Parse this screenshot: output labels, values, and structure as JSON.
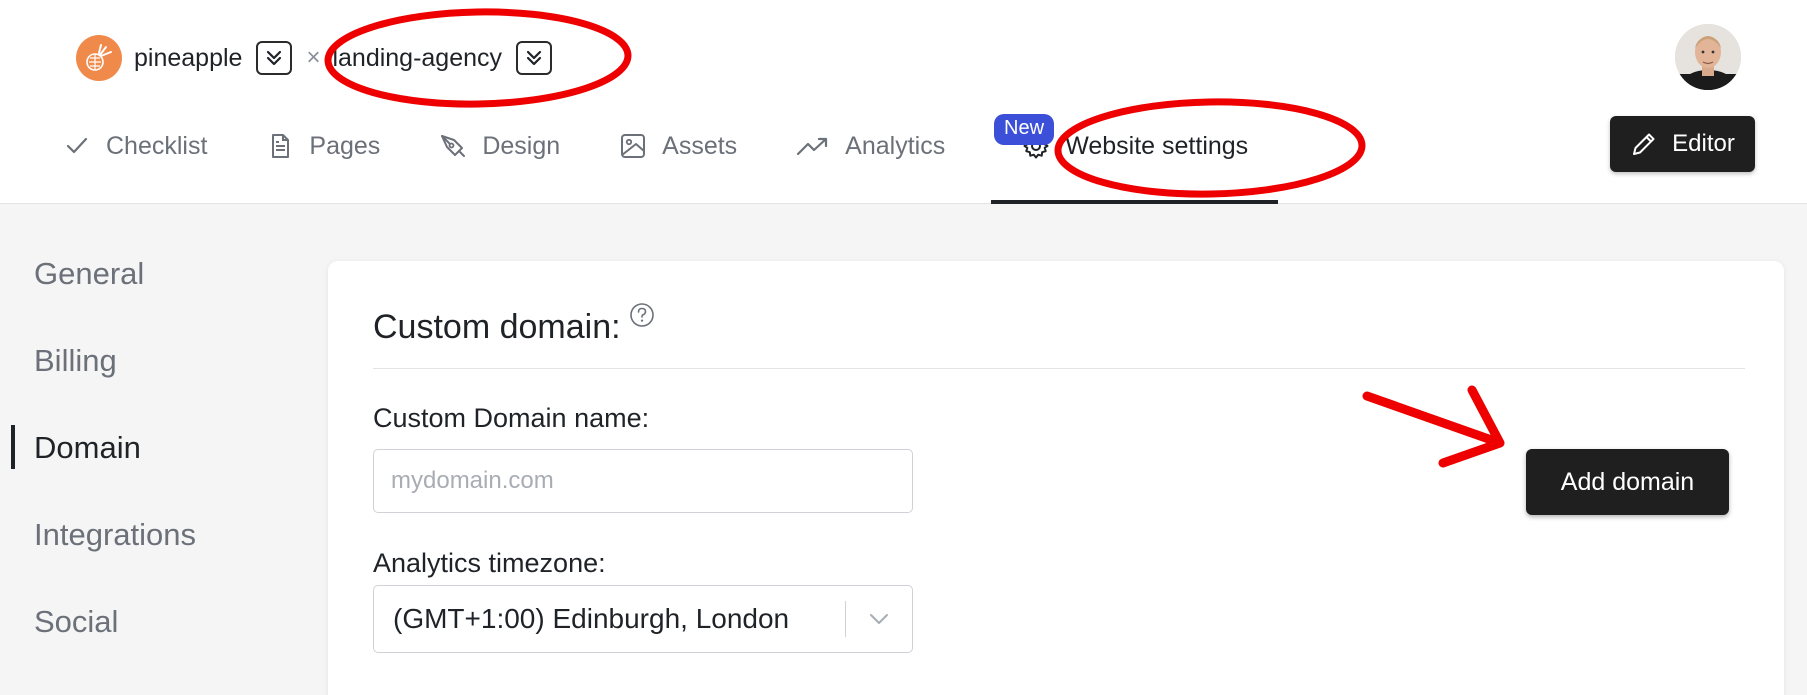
{
  "header": {
    "project_name": "pineapple",
    "separator": "×",
    "site_name": "landing-agency",
    "tabs": [
      {
        "label": "Checklist",
        "icon": "check-icon"
      },
      {
        "label": "Pages",
        "icon": "document-icon"
      },
      {
        "label": "Design",
        "icon": "pen-tool-icon"
      },
      {
        "label": "Assets",
        "icon": "image-icon"
      },
      {
        "label": "Analytics",
        "icon": "trend-up-icon"
      },
      {
        "label": "Website settings",
        "icon": "gear-icon",
        "active": true
      }
    ],
    "analytics_badge": "New",
    "editor_label": "Editor"
  },
  "sidebar": {
    "items": [
      {
        "label": "General"
      },
      {
        "label": "Billing"
      },
      {
        "label": "Domain",
        "active": true
      },
      {
        "label": "Integrations"
      },
      {
        "label": "Social"
      }
    ]
  },
  "domain_card": {
    "title": "Custom domain:",
    "domain_label": "Custom Domain name:",
    "domain_placeholder": "mydomain.com",
    "domain_value": "",
    "timezone_label": "Analytics timezone:",
    "timezone_value": "(GMT+1:00) Edinburgh, London",
    "add_button": "Add domain"
  },
  "colors": {
    "accent_dark": "#1f1f1f",
    "badge_blue": "#3b4fd8",
    "logo_orange": "#f08a4b",
    "annotation_red": "#ee0000"
  }
}
